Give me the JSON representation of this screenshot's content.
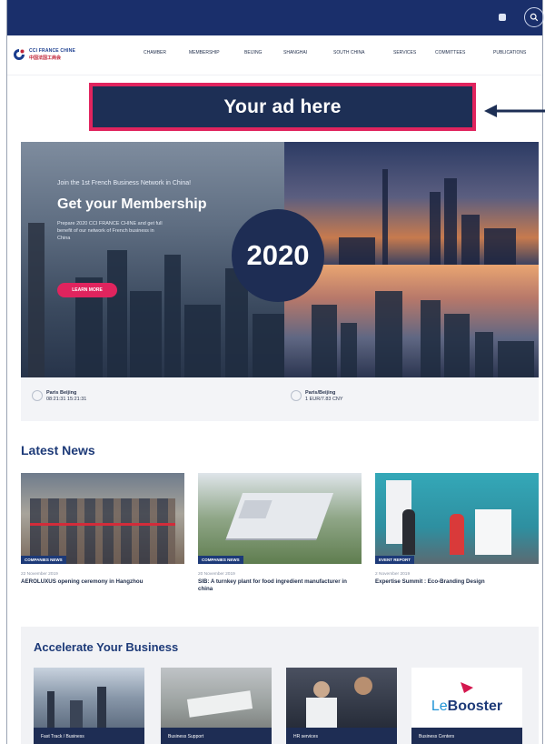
{
  "colors": {
    "top_bar": "#1a2f6b",
    "ad_border": "#e0245e",
    "ad_bg": "#1d2f55",
    "accent": "#e0245e",
    "navy": "#1d3a78"
  },
  "topbar": {
    "icons": [
      "language-icon",
      "search-icon"
    ]
  },
  "logo": {
    "line1": "CCI FRANCE CHINE",
    "line2": "中国法国工商会"
  },
  "nav": [
    "CHAMBER",
    "MEMBERSHIP",
    "BEIJING",
    "SHANGHAI",
    "SOUTH CHINA",
    "SERVICES",
    "COMMITTEES",
    "PUBLICATIONS"
  ],
  "ad": {
    "label": "Your ad here"
  },
  "hero": {
    "kicker": "Join the 1st French Business Network in China!",
    "title": "Get your Membership",
    "body": "Prepare 2020 CCI FRANCE CHINE and get full benefit of our network of French business in China",
    "cta": "LEARN MORE",
    "badge": "2020"
  },
  "clocks": [
    {
      "title": "Paris  Beijing",
      "value": "08:21:31 15:21:31"
    },
    {
      "title": "Paris/Beijing",
      "value": "1 EUR/7.83 CNY"
    }
  ],
  "latest_news": {
    "title": "Latest News",
    "items": [
      {
        "tag": "COMPANIES NEWS",
        "date": "22 November 2019",
        "title": "AEROLUXUS opening ceremony in Hangzhou"
      },
      {
        "tag": "COMPANIES NEWS",
        "date": "20 November 2019",
        "title": "SIB: A turnkey plant for food ingredient manufacturer in china"
      },
      {
        "tag": "EVENT REPORT",
        "date": "2 November 2019",
        "title": "Expertise Summit : Eco-Branding Design"
      }
    ]
  },
  "accelerate": {
    "title": "Accelerate Your Business",
    "cards": [
      {
        "label": "Fast Track / Business"
      },
      {
        "label": "Business Support"
      },
      {
        "label": "HR services"
      },
      {
        "label": "Business Centers",
        "logo_prefix": "Le",
        "logo_main": "Booster"
      }
    ]
  }
}
